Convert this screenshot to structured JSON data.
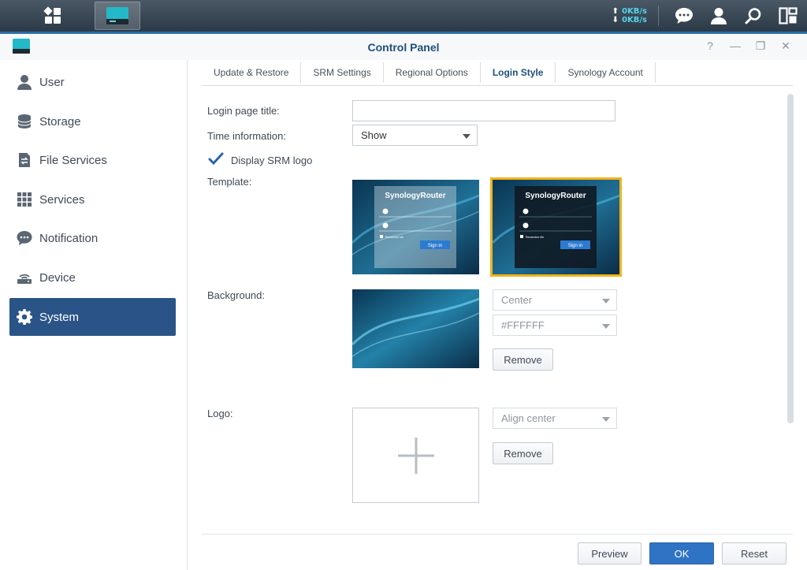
{
  "taskbar": {
    "upload_speed": "0KB/s",
    "download_speed": "0KB/s",
    "icons": [
      "main-menu-icon",
      "control-panel-app-icon",
      "chat-icon",
      "user-icon",
      "search-icon",
      "widgets-icon"
    ]
  },
  "window": {
    "title": "Control Panel",
    "controls": [
      "help-icon",
      "minimize-icon",
      "restore-icon",
      "close-icon"
    ]
  },
  "sidebar": {
    "items": [
      {
        "label": "User",
        "icon": "user-icon"
      },
      {
        "label": "Storage",
        "icon": "storage-icon"
      },
      {
        "label": "File Services",
        "icon": "file-services-icon"
      },
      {
        "label": "Services",
        "icon": "services-grid-icon"
      },
      {
        "label": "Notification",
        "icon": "notification-bubble-icon"
      },
      {
        "label": "Device",
        "icon": "router-device-icon"
      },
      {
        "label": "System",
        "icon": "gear-icon",
        "active": true
      }
    ]
  },
  "tabs": [
    {
      "label": "Update & Restore"
    },
    {
      "label": "SRM Settings"
    },
    {
      "label": "Regional Options"
    },
    {
      "label": "Login Style",
      "active": true
    },
    {
      "label": "Synology Account"
    }
  ],
  "form": {
    "login_title_label": "Login page title:",
    "login_title_value": "",
    "time_info_label": "Time information:",
    "time_info_value": "Show",
    "display_logo_label": "Display SRM logo",
    "display_logo_checked": true,
    "template_label": "Template:",
    "template_brand": "SynologyRouter",
    "template_remember": "Remember Me",
    "template_signin": "Sign in",
    "background_label": "Background:",
    "background_position": "Center",
    "background_color": "#FFFFFF",
    "background_remove": "Remove",
    "logo_label": "Logo:",
    "logo_align": "Align center",
    "logo_remove": "Remove"
  },
  "footer": {
    "preview": "Preview",
    "ok": "OK",
    "reset": "Reset"
  },
  "colors": {
    "accent": "#2a5487",
    "title": "#1d4f7c",
    "ok_button": "#2f73c5",
    "selected_template": "#f2b31b"
  }
}
